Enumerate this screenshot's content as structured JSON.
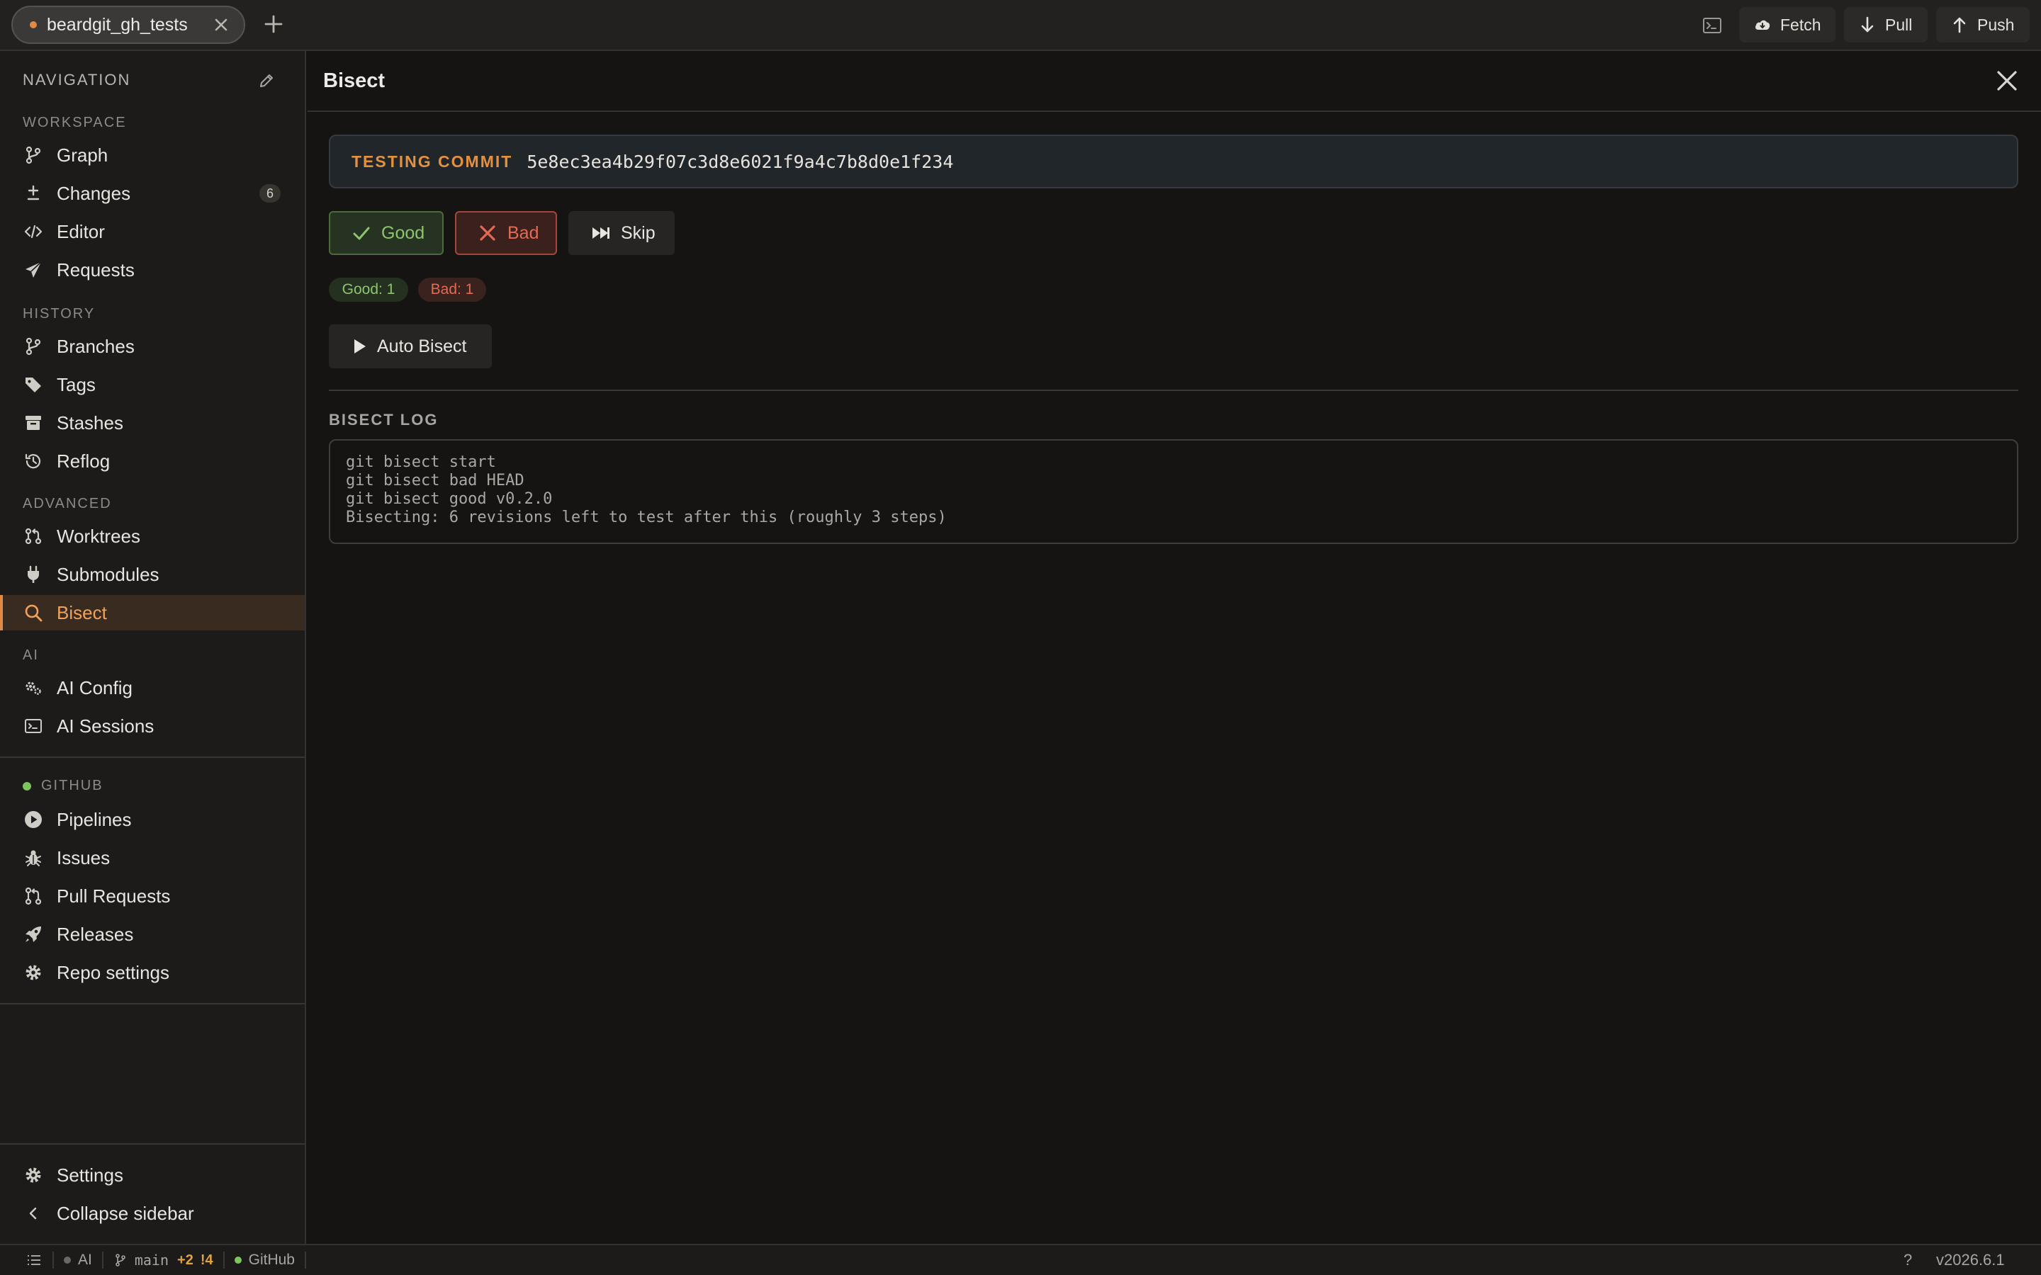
{
  "tab": {
    "title": "beardgit_gh_tests"
  },
  "toolbar": {
    "fetch_label": "Fetch",
    "pull_label": "Pull",
    "push_label": "Push"
  },
  "sidebar": {
    "header": "NAVIGATION",
    "sections": {
      "workspace": "WORKSPACE",
      "history": "HISTORY",
      "advanced": "ADVANCED",
      "ai": "AI",
      "github": "GITHUB"
    },
    "items": {
      "graph": "Graph",
      "changes": "Changes",
      "changes_count": "6",
      "editor": "Editor",
      "requests": "Requests",
      "branches": "Branches",
      "tags": "Tags",
      "stashes": "Stashes",
      "reflog": "Reflog",
      "worktrees": "Worktrees",
      "submodules": "Submodules",
      "bisect": "Bisect",
      "ai_config": "AI Config",
      "ai_sessions": "AI Sessions",
      "pipelines": "Pipelines",
      "issues": "Issues",
      "pull_requests": "Pull Requests",
      "releases": "Releases",
      "repo_settings": "Repo settings"
    },
    "footer": {
      "settings": "Settings",
      "collapse": "Collapse sidebar"
    },
    "active_item": "Bisect",
    "github_status_color": "#7ec45c"
  },
  "main": {
    "title": "Bisect",
    "testing_label": "TESTING COMMIT",
    "commit_hash": "5e8ec3ea4b29f07c3d8e6021f9a4c7b8d0e1f234",
    "buttons": {
      "good": "Good",
      "bad": "Bad",
      "skip": "Skip",
      "auto": "Auto Bisect"
    },
    "counts": {
      "good": "Good: 1",
      "bad": "Bad: 1"
    },
    "log_title": "BISECT LOG",
    "log_lines": "git bisect start\ngit bisect bad HEAD\ngit bisect good v0.2.0\nBisecting: 6 revisions left to test after this (roughly 3 steps)"
  },
  "statusbar": {
    "ai": "AI",
    "branch": "main",
    "ahead": "+2",
    "changes": "!4",
    "github": "GitHub",
    "help": "?",
    "version": "v2026.6.1"
  },
  "colors": {
    "accent": "#e08a45",
    "good": "#8ec46e",
    "bad": "#e46a54",
    "background": "#151413"
  }
}
